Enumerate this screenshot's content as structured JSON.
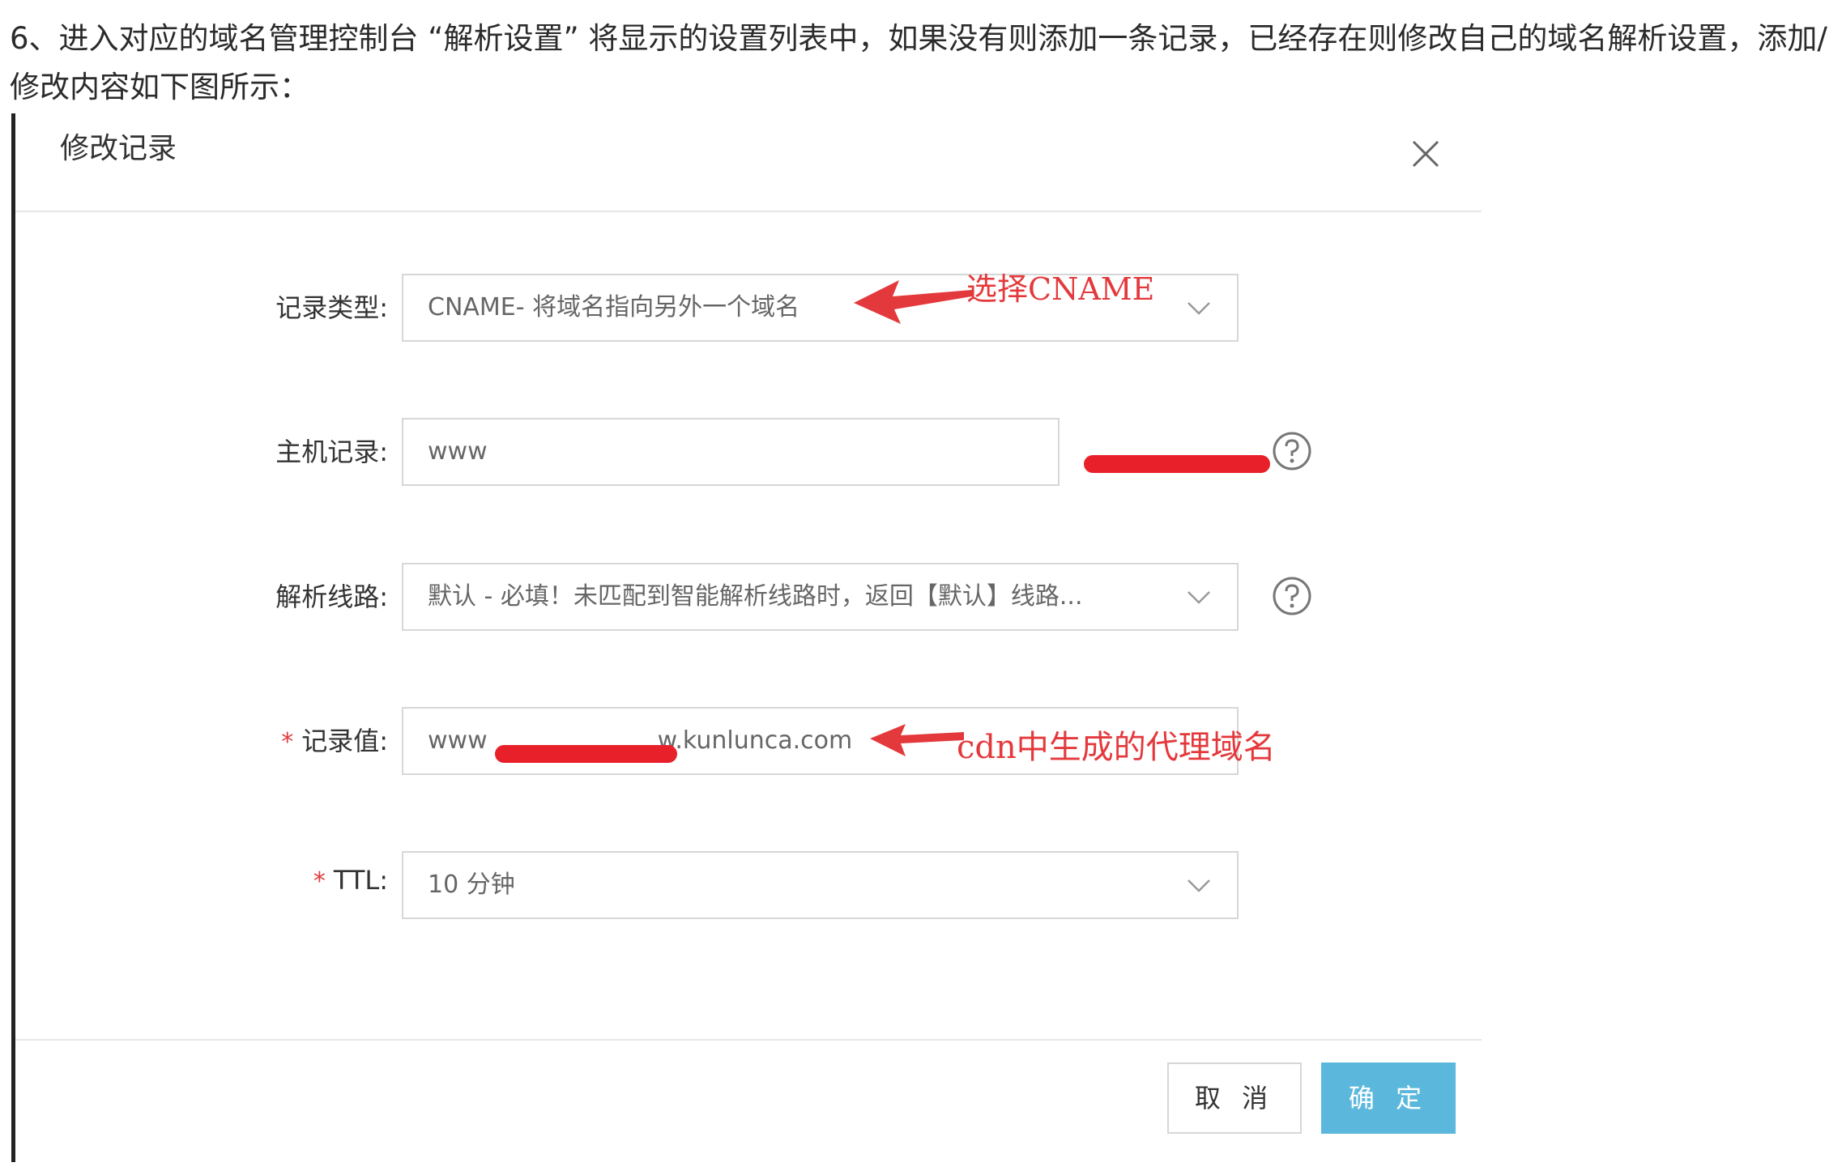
{
  "intro_text": "6、进入对应的域名管理控制台 “解析设置” 将显示的设置列表中，如果没有则添加一条记录，已经存在则修改自己的域名解析设置，添加/修改内容如下图所示：",
  "dialog": {
    "title": "修改记录",
    "close_icon": "close-icon",
    "fields": {
      "record_type": {
        "label": "记录类型:",
        "value": "CNAME- 将域名指向另外一个域名",
        "icon": "chevron-down-icon"
      },
      "host": {
        "label": "主机记录:",
        "value": "www",
        "help_icon": "question-circle-icon"
      },
      "line": {
        "label": "解析线路:",
        "value": "默认 - 必填！未匹配到智能解析线路时，返回【默认】线路...",
        "icon": "chevron-down-icon",
        "help_icon": "question-circle-icon"
      },
      "record_value": {
        "required_mark": "*",
        "label": "记录值:",
        "value_start": "www",
        "value_end": "w.kunlunca.com"
      },
      "ttl": {
        "required_mark": "*",
        "label": "TTL:",
        "value": "10 分钟",
        "icon": "chevron-down-icon"
      }
    },
    "buttons": {
      "cancel": "取 消",
      "ok": "确 定"
    }
  },
  "annotations": {
    "select_cname": "选择CNAME",
    "cdn_proxy": "cdn中生成的代理域名"
  },
  "colors": {
    "annotation_red": "#e4393c",
    "redaction_red": "#e8202a",
    "ok_button": "#5bb8dc",
    "border": "#d7d7d7"
  }
}
